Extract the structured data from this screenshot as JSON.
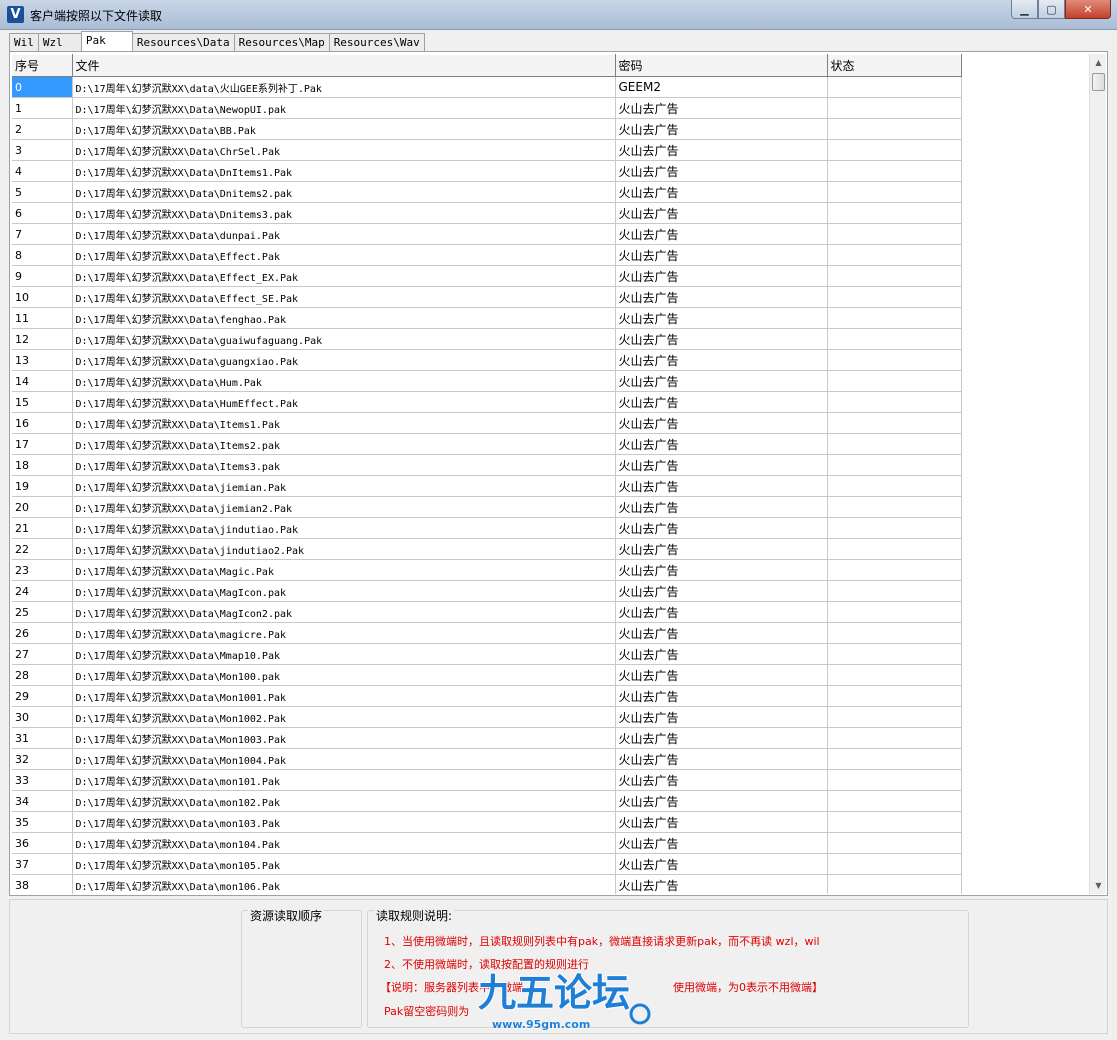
{
  "window": {
    "title": "客户端按照以下文件读取",
    "icon_letter": "V",
    "minimize": "▁",
    "maximize": "▢",
    "close": "✕"
  },
  "tabs": [
    "Wil",
    "Wzl",
    "Pak",
    "Resources\\Data",
    "Resources\\Map",
    "Resources\\Wav"
  ],
  "active_tab": "Pak",
  "table": {
    "headers": [
      "序号",
      "文件",
      "密码",
      "状态"
    ],
    "rows": [
      {
        "idx": "0",
        "file": "D:\\17周年\\幻梦沉默XX\\data\\火山GEE系列补丁.Pak",
        "pwd": "GEEM2",
        "status": ""
      },
      {
        "idx": "1",
        "file": "D:\\17周年\\幻梦沉默XX\\Data\\NewopUI.pak",
        "pwd": "火山去广告",
        "status": ""
      },
      {
        "idx": "2",
        "file": "D:\\17周年\\幻梦沉默XX\\Data\\BB.Pak",
        "pwd": "火山去广告",
        "status": ""
      },
      {
        "idx": "3",
        "file": "D:\\17周年\\幻梦沉默XX\\Data\\ChrSel.Pak",
        "pwd": "火山去广告",
        "status": ""
      },
      {
        "idx": "4",
        "file": "D:\\17周年\\幻梦沉默XX\\Data\\DnItems1.Pak",
        "pwd": "火山去广告",
        "status": ""
      },
      {
        "idx": "5",
        "file": "D:\\17周年\\幻梦沉默XX\\Data\\Dnitems2.pak",
        "pwd": "火山去广告",
        "status": ""
      },
      {
        "idx": "6",
        "file": "D:\\17周年\\幻梦沉默XX\\Data\\Dnitems3.pak",
        "pwd": "火山去广告",
        "status": ""
      },
      {
        "idx": "7",
        "file": "D:\\17周年\\幻梦沉默XX\\Data\\dunpai.Pak",
        "pwd": "火山去广告",
        "status": ""
      },
      {
        "idx": "8",
        "file": "D:\\17周年\\幻梦沉默XX\\Data\\Effect.Pak",
        "pwd": "火山去广告",
        "status": ""
      },
      {
        "idx": "9",
        "file": "D:\\17周年\\幻梦沉默XX\\Data\\Effect_EX.Pak",
        "pwd": "火山去广告",
        "status": ""
      },
      {
        "idx": "10",
        "file": "D:\\17周年\\幻梦沉默XX\\Data\\Effect_SE.Pak",
        "pwd": "火山去广告",
        "status": ""
      },
      {
        "idx": "11",
        "file": "D:\\17周年\\幻梦沉默XX\\Data\\fenghao.Pak",
        "pwd": "火山去广告",
        "status": ""
      },
      {
        "idx": "12",
        "file": "D:\\17周年\\幻梦沉默XX\\Data\\guaiwufaguang.Pak",
        "pwd": "火山去广告",
        "status": ""
      },
      {
        "idx": "13",
        "file": "D:\\17周年\\幻梦沉默XX\\Data\\guangxiao.Pak",
        "pwd": "火山去广告",
        "status": ""
      },
      {
        "idx": "14",
        "file": "D:\\17周年\\幻梦沉默XX\\Data\\Hum.Pak",
        "pwd": "火山去广告",
        "status": ""
      },
      {
        "idx": "15",
        "file": "D:\\17周年\\幻梦沉默XX\\Data\\HumEffect.Pak",
        "pwd": "火山去广告",
        "status": ""
      },
      {
        "idx": "16",
        "file": "D:\\17周年\\幻梦沉默XX\\Data\\Items1.Pak",
        "pwd": "火山去广告",
        "status": ""
      },
      {
        "idx": "17",
        "file": "D:\\17周年\\幻梦沉默XX\\Data\\Items2.pak",
        "pwd": "火山去广告",
        "status": ""
      },
      {
        "idx": "18",
        "file": "D:\\17周年\\幻梦沉默XX\\Data\\Items3.pak",
        "pwd": "火山去广告",
        "status": ""
      },
      {
        "idx": "19",
        "file": "D:\\17周年\\幻梦沉默XX\\Data\\jiemian.Pak",
        "pwd": "火山去广告",
        "status": ""
      },
      {
        "idx": "20",
        "file": "D:\\17周年\\幻梦沉默XX\\Data\\jiemian2.Pak",
        "pwd": "火山去广告",
        "status": ""
      },
      {
        "idx": "21",
        "file": "D:\\17周年\\幻梦沉默XX\\Data\\jindutiao.Pak",
        "pwd": "火山去广告",
        "status": ""
      },
      {
        "idx": "22",
        "file": "D:\\17周年\\幻梦沉默XX\\Data\\jindutiao2.Pak",
        "pwd": "火山去广告",
        "status": ""
      },
      {
        "idx": "23",
        "file": "D:\\17周年\\幻梦沉默XX\\Data\\Magic.Pak",
        "pwd": "火山去广告",
        "status": ""
      },
      {
        "idx": "24",
        "file": "D:\\17周年\\幻梦沉默XX\\Data\\MagIcon.pak",
        "pwd": "火山去广告",
        "status": ""
      },
      {
        "idx": "25",
        "file": "D:\\17周年\\幻梦沉默XX\\Data\\MagIcon2.pak",
        "pwd": "火山去广告",
        "status": ""
      },
      {
        "idx": "26",
        "file": "D:\\17周年\\幻梦沉默XX\\Data\\magicre.Pak",
        "pwd": "火山去广告",
        "status": ""
      },
      {
        "idx": "27",
        "file": "D:\\17周年\\幻梦沉默XX\\Data\\Mmap10.Pak",
        "pwd": "火山去广告",
        "status": ""
      },
      {
        "idx": "28",
        "file": "D:\\17周年\\幻梦沉默XX\\Data\\Mon100.pak",
        "pwd": "火山去广告",
        "status": ""
      },
      {
        "idx": "29",
        "file": "D:\\17周年\\幻梦沉默XX\\Data\\Mon1001.Pak",
        "pwd": "火山去广告",
        "status": ""
      },
      {
        "idx": "30",
        "file": "D:\\17周年\\幻梦沉默XX\\Data\\Mon1002.Pak",
        "pwd": "火山去广告",
        "status": ""
      },
      {
        "idx": "31",
        "file": "D:\\17周年\\幻梦沉默XX\\Data\\Mon1003.Pak",
        "pwd": "火山去广告",
        "status": ""
      },
      {
        "idx": "32",
        "file": "D:\\17周年\\幻梦沉默XX\\Data\\Mon1004.Pak",
        "pwd": "火山去广告",
        "status": ""
      },
      {
        "idx": "33",
        "file": "D:\\17周年\\幻梦沉默XX\\Data\\mon101.Pak",
        "pwd": "火山去广告",
        "status": ""
      },
      {
        "idx": "34",
        "file": "D:\\17周年\\幻梦沉默XX\\Data\\mon102.Pak",
        "pwd": "火山去广告",
        "status": ""
      },
      {
        "idx": "35",
        "file": "D:\\17周年\\幻梦沉默XX\\Data\\mon103.Pak",
        "pwd": "火山去广告",
        "status": ""
      },
      {
        "idx": "36",
        "file": "D:\\17周年\\幻梦沉默XX\\Data\\mon104.Pak",
        "pwd": "火山去广告",
        "status": ""
      },
      {
        "idx": "37",
        "file": "D:\\17周年\\幻梦沉默XX\\Data\\mon105.Pak",
        "pwd": "火山去广告",
        "status": ""
      },
      {
        "idx": "38",
        "file": "D:\\17周年\\幻梦沉默XX\\Data\\mon106.Pak",
        "pwd": "火山去广告",
        "status": ""
      }
    ],
    "selected_row": "0"
  },
  "bottom": {
    "order_title": "资源读取顺序",
    "rules_title": "读取规则说明:",
    "rules": [
      "1、当使用微端时，且读取规则列表中有pak，微端直接请求更新pak，而不再读 wzl，wil",
      "2、不使用微端时，读取按配置的规则进行",
      "【说明：服务器列表中，微端",
      "Pak留空密码则为"
    ],
    "rule3_tail": "使用微端，为0表示不用微端】",
    "rule_color": "#e00000"
  },
  "watermark": {
    "text": "九五论坛",
    "url": "www.95gm.com"
  },
  "colors": {
    "selection": "#3399ff",
    "titlebar": "#b9cadf"
  }
}
